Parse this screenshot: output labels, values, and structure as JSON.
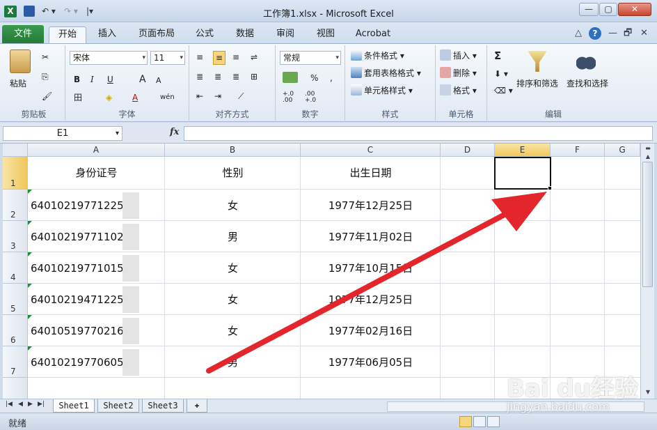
{
  "window": {
    "title": "工作簿1.xlsx - Microsoft Excel",
    "app_icon": "X",
    "undo": "↶ ▾",
    "redo": "↷ ▾",
    "customize": "|▾",
    "min": "—",
    "max": "▢",
    "close": "✕"
  },
  "tabs": {
    "file": "文件",
    "items": [
      "开始",
      "插入",
      "页面布局",
      "公式",
      "数据",
      "审阅",
      "视图",
      "Acrobat"
    ],
    "active_index": 0,
    "right_caret": "△",
    "help": "?",
    "ribbon_min": "—",
    "ribbon_restore": "🗗",
    "ribbon_close": "✕"
  },
  "ribbon": {
    "clipboard": {
      "label": "剪贴板",
      "paste": "粘贴",
      "cut": "✂",
      "copy": "⎘",
      "painter": "🖌"
    },
    "font": {
      "label": "字体",
      "name": "宋体",
      "size": "11",
      "bold": "B",
      "italic": "I",
      "underline": "U",
      "grow": "A",
      "shrink": "A",
      "border": "田",
      "fill": "◈",
      "color": "A",
      "phonetic": "wén"
    },
    "align": {
      "label": "对齐方式"
    },
    "number": {
      "label": "数字",
      "format": "常规",
      "percent": "%",
      "comma": ",",
      "inc": "+.0 .00",
      "dec": ".00 +.0"
    },
    "styles": {
      "label": "样式",
      "conditional": "条件格式",
      "table": "套用表格格式",
      "cell": "单元格样式"
    },
    "cells": {
      "label": "单元格",
      "insert": "插入",
      "delete": "删除",
      "format": "格式"
    },
    "editing": {
      "label": "编辑",
      "sum": "Σ",
      "sort": "排序和筛选",
      "find": "查找和选择"
    }
  },
  "formula_bar": {
    "name_box": "E1",
    "fx": "fx",
    "value": ""
  },
  "columns": [
    "A",
    "B",
    "C",
    "D",
    "E",
    "F",
    "G"
  ],
  "selected_column": "E",
  "rows": [
    "1",
    "2",
    "3",
    "4",
    "5",
    "6",
    "7"
  ],
  "selected_row": "1",
  "table": {
    "headers": [
      "身份证号",
      "性别",
      "出生日期"
    ],
    "data": [
      [
        "64010219771225",
        "女",
        "1977年12月25日"
      ],
      [
        "64010219771102",
        "男",
        "1977年11月02日"
      ],
      [
        "64010219771015",
        "女",
        "1977年10月15日"
      ],
      [
        "64010219471225",
        "女",
        "1977年12月25日"
      ],
      [
        "64010519770216",
        "女",
        "1977年02月16日"
      ],
      [
        "64010219770605",
        "男",
        "1977年06月05日"
      ]
    ]
  },
  "sheets": [
    "Sheet1",
    "Sheet2",
    "Sheet3"
  ],
  "active_sheet": "Sheet1",
  "status": {
    "mode": "就绪"
  },
  "watermark": {
    "main": "Bai du经验",
    "sub": "jingyan.baidu.com"
  },
  "colors": {
    "selection_border": "#111111",
    "arrow": "#e3262c",
    "file_tab": "#2a8a3e"
  }
}
